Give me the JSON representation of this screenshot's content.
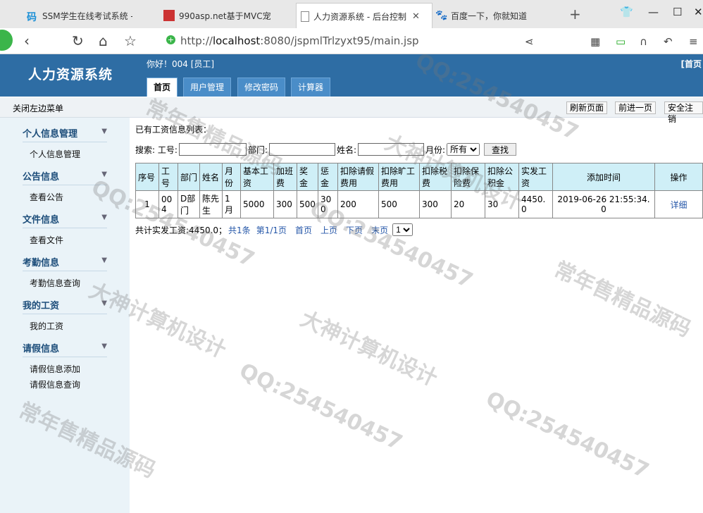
{
  "browser": {
    "tabs": [
      {
        "label": "SSM学生在线考试系统 -"
      },
      {
        "label": "990asp.net基于MVC宠"
      },
      {
        "label": "人力资源系统 - 后台控制"
      },
      {
        "label": "百度一下，你就知道"
      }
    ],
    "url_prefix": "http://",
    "url_host": "localhost",
    "url_rest": ":8080/jspmlTrlzyxt95/main.jsp"
  },
  "header": {
    "logo": "人力资源系统",
    "greeting": "你好！004 [员工]",
    "home_link": "[首页",
    "tabs": [
      "首页",
      "用户管理",
      "修改密码",
      "计算器"
    ]
  },
  "toolbar": {
    "close_menu": "关闭左边菜单",
    "refresh": "刷新页面",
    "forward": "前进一页",
    "logout": "安全注销"
  },
  "sidebar": [
    {
      "title": "个人信息管理",
      "items": [
        "个人信息管理"
      ]
    },
    {
      "title": "公告信息",
      "items": [
        "查看公告"
      ]
    },
    {
      "title": "文件信息",
      "items": [
        "查看文件"
      ]
    },
    {
      "title": "考勤信息",
      "items": [
        "考勤信息查询"
      ]
    },
    {
      "title": "我的工资",
      "items": [
        "我的工资"
      ]
    },
    {
      "title": "请假信息",
      "items": [
        "请假信息添加",
        "请假信息查询"
      ]
    }
  ],
  "main": {
    "title": "已有工资信息列表：",
    "search": {
      "prefix": "搜索: 工号:",
      "dept_label": "部门:",
      "name_label": "姓名:",
      "month_label": "月份:",
      "month_value": "所有",
      "button": "查找"
    },
    "columns": [
      "序号",
      "工号",
      "部门",
      "姓名",
      "月份",
      "基本工资",
      "加班费",
      "奖金",
      "惩金",
      "扣除请假费用",
      "扣除旷工费用",
      "扣除税费",
      "扣除保险费",
      "扣除公积金",
      "实发工资",
      "添加时间",
      "操作"
    ],
    "rows": [
      [
        "1",
        "004",
        "D部门",
        "陈先生",
        "1月",
        "5000",
        "300",
        "500",
        "300",
        "200",
        "500",
        "300",
        "20",
        "30",
        "4450.0",
        "2019-06-26 21:55:34.0",
        "详细"
      ]
    ],
    "footer": {
      "total": "共计实发工资:4450.0；",
      "count": "共1条",
      "page": "第1/1页",
      "first": "首页",
      "prev": "上页",
      "next": "下页",
      "last": "末页",
      "page_select": "1"
    }
  },
  "watermarks": [
    "常年售精品源码",
    "QQ:254540457",
    "大神计算机设计"
  ]
}
